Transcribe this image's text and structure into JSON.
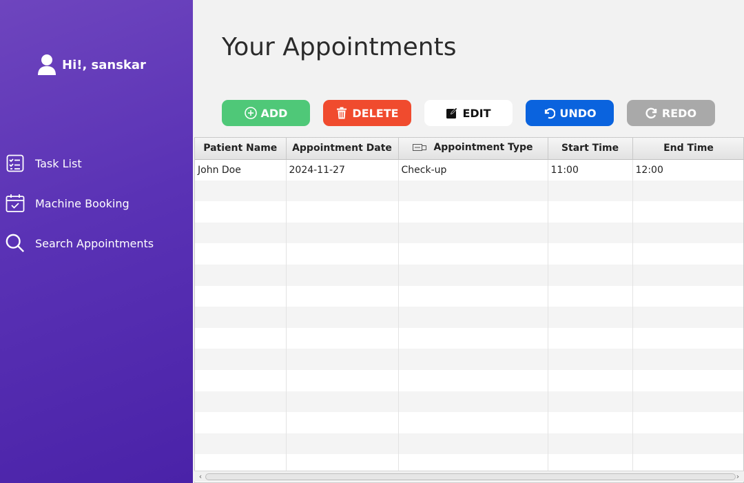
{
  "sidebar": {
    "greeting": "Hi!, sanskar",
    "items": [
      {
        "label": "Task List",
        "icon": "task-list-icon"
      },
      {
        "label": "Machine Booking",
        "icon": "calendar-check-icon"
      },
      {
        "label": "Search Appointments",
        "icon": "search-icon"
      }
    ]
  },
  "main": {
    "title": "Your Appointments",
    "toolbar": {
      "add": "ADD",
      "delete": "DELETE",
      "edit": "EDIT",
      "undo": "UNDO",
      "redo": "REDO"
    },
    "table": {
      "columns": [
        "Patient Name",
        "Appointment Date",
        "Appointment Type",
        "Start Time",
        "End Time"
      ],
      "rows": [
        [
          "John Doe",
          "2024-11-27",
          "Check-up",
          "11:00",
          "12:00"
        ]
      ]
    }
  },
  "colors": {
    "sidebar_top": "#6e45be",
    "sidebar_bottom": "#4a22a8",
    "add": "#4fc878",
    "delete": "#f04b2e",
    "edit": "#ffffff",
    "undo": "#0a63de",
    "redo": "#a9a9a9"
  }
}
